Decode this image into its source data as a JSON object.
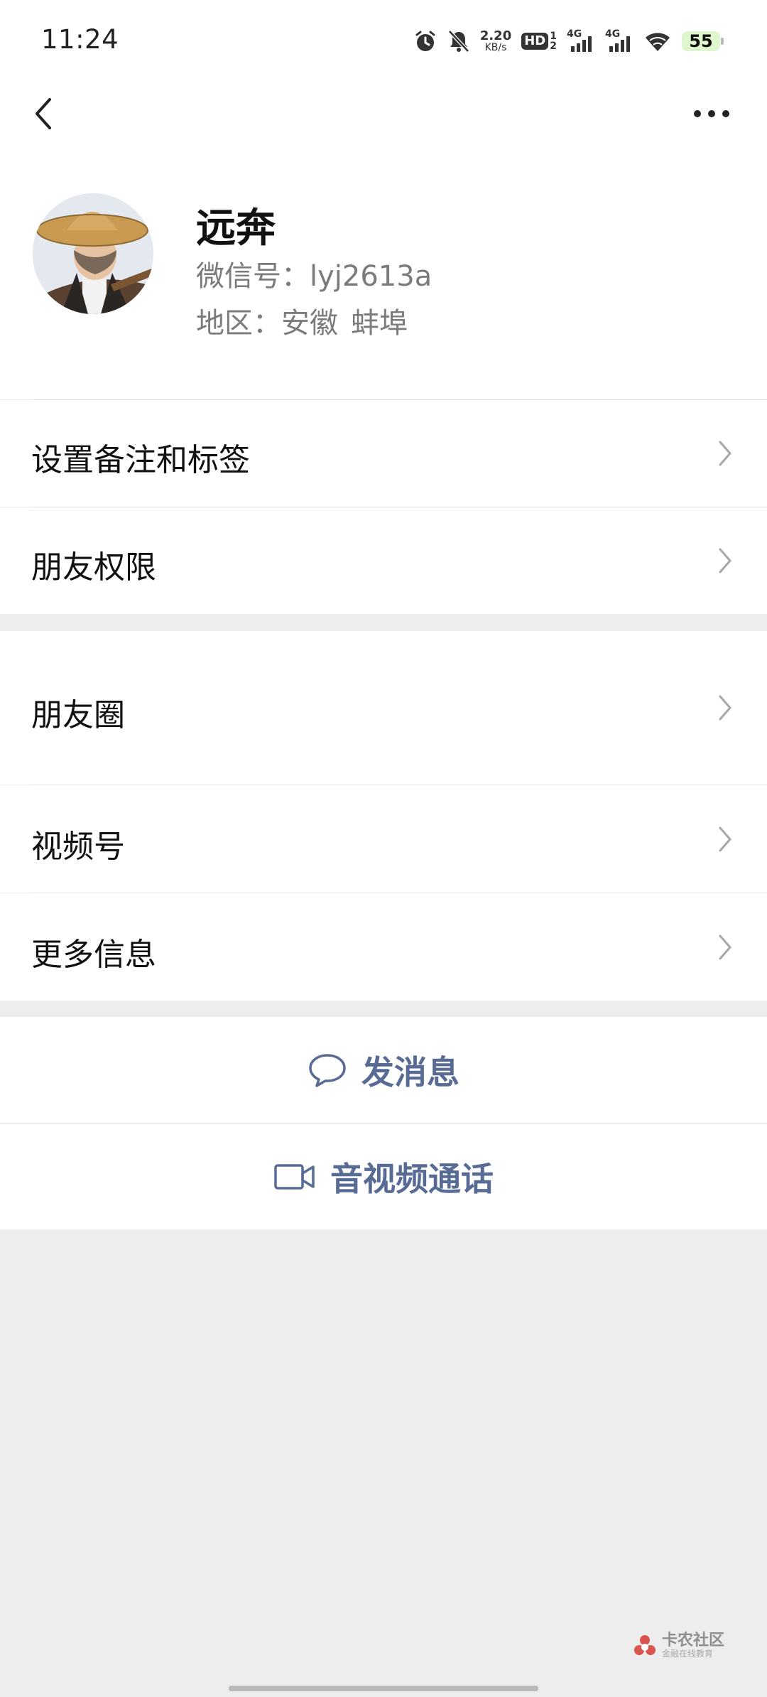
{
  "status_bar": {
    "time": "11:24",
    "net_speed_value": "2.20",
    "net_speed_unit": "KB/s",
    "hd_label": "HD",
    "hd_sup": "1",
    "hd_sub": "2",
    "sim1_label": "4G",
    "sim2_label": "4G",
    "battery": "55"
  },
  "nav": {
    "back_icon": "chevron-left-icon",
    "more_icon": "more-dots-icon"
  },
  "profile": {
    "name": "远奔",
    "wechat_id": "微信号：lyj2613a",
    "region_label": "地区：安徽",
    "region_city": "蚌埠"
  },
  "list_group_1": [
    {
      "label": "设置备注和标签"
    },
    {
      "label": "朋友权限"
    }
  ],
  "list_group_2": [
    {
      "label": "朋友圈"
    },
    {
      "label": "视频号"
    },
    {
      "label": "更多信息"
    }
  ],
  "actions": {
    "message": "发消息",
    "call": "音视频通话"
  },
  "watermark": {
    "title": "卡农社区",
    "subtitle": "金融在线教育"
  },
  "colors": {
    "accent": "#576b95",
    "background": "#ededed",
    "panel": "#ffffff"
  }
}
